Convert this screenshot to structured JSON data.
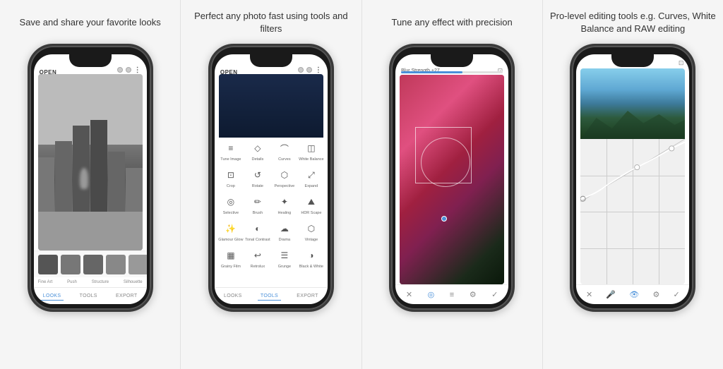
{
  "panels": [
    {
      "id": "panel1",
      "caption": "Save and share your favorite looks",
      "phone": {
        "header_left": "OPEN",
        "screen_type": "looks",
        "filter_labels": [
          "Fine Art",
          "Push",
          "Structure",
          "Silhouette"
        ],
        "nav_items": [
          {
            "label": "LOOKS",
            "active": true
          },
          {
            "label": "TOOLS",
            "active": false
          },
          {
            "label": "EXPORT",
            "active": false
          }
        ]
      }
    },
    {
      "id": "panel2",
      "caption": "Perfect any photo fast using tools and filters",
      "phone": {
        "header_left": "OPEN",
        "screen_type": "tools",
        "tools": [
          {
            "icon": "≡≡",
            "label": "Tune Image"
          },
          {
            "icon": "▽",
            "label": "Details"
          },
          {
            "icon": "⌒",
            "label": "Curves"
          },
          {
            "icon": "◫",
            "label": "White Balance"
          },
          {
            "icon": "⊡",
            "label": "Crop"
          },
          {
            "icon": "↺",
            "label": "Rotate"
          },
          {
            "icon": "⬡",
            "label": "Perspective"
          },
          {
            "icon": "⤢",
            "label": "Expand"
          },
          {
            "icon": "◎",
            "label": "Selective"
          },
          {
            "icon": "✏",
            "label": "Brush"
          },
          {
            "icon": "✦",
            "label": "Healing"
          },
          {
            "icon": "⛰",
            "label": "HDR Scape"
          },
          {
            "icon": "✨",
            "label": "Glamour Glow"
          },
          {
            "icon": "◐",
            "label": "Tonal Contrast"
          },
          {
            "icon": "☁",
            "label": "Drama"
          },
          {
            "icon": "⬡",
            "label": "Vintage"
          },
          {
            "icon": "▦",
            "label": "Grainy Film"
          },
          {
            "icon": "↩",
            "label": "Retrolux"
          },
          {
            "icon": "☰",
            "label": "Grunge"
          },
          {
            "icon": "◑",
            "label": "Black & White"
          }
        ],
        "nav_items": [
          {
            "label": "LOOKS",
            "active": false
          },
          {
            "label": "TOOLS",
            "active": true
          },
          {
            "label": "EXPORT",
            "active": false
          }
        ]
      }
    },
    {
      "id": "panel3",
      "caption": "Tune any effect with precision",
      "phone": {
        "screen_type": "blur",
        "blur_label": "Blur Strength +27",
        "nav_icons": [
          "✕",
          "◎",
          "≡≡",
          "🔔",
          "✓"
        ]
      }
    },
    {
      "id": "panel4",
      "caption": "Pro-level editing tools e.g. Curves, White Balance and RAW editing",
      "phone": {
        "screen_type": "curves",
        "nav_icons": [
          "✕",
          "🎤",
          "👁",
          "🔔",
          "✓"
        ]
      }
    }
  ]
}
